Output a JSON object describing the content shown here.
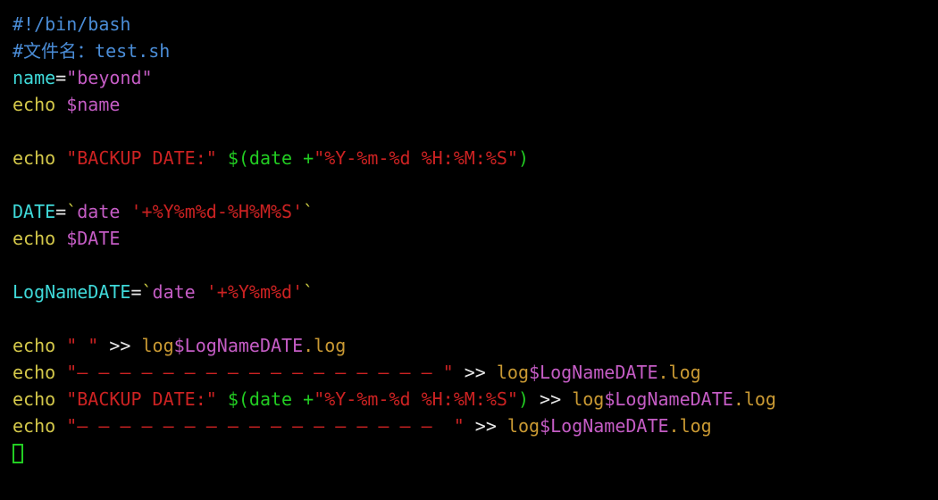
{
  "code": {
    "l1_shebang": "#!/bin/bash",
    "l2_comment": "#文件名：test.sh",
    "l3_name": "name",
    "l3_eq": "=",
    "l3_val": "\"beyond\"",
    "l4_echo": "echo",
    "l4_var": " $name",
    "l6_echo": "echo",
    "l6_str": " \"BACKUP DATE:\"",
    "l6_sub_open": " $(",
    "l6_date": "date ",
    "l6_plus": "+",
    "l6_fmt": "\"%Y-%m-%d %H:%M:%S\"",
    "l6_sub_close": ")",
    "l8_var": "DATE",
    "l8_eq": "=",
    "l8_bt1": "`",
    "l8_date": "date ",
    "l8_fmt": "'+%Y%m%d-%H%M%S'",
    "l8_bt2": "`",
    "l9_echo": "echo",
    "l9_var": " $DATE",
    "l11_var": "LogNameDATE",
    "l11_eq": "=",
    "l11_bt1": "`",
    "l11_date": "date ",
    "l11_fmt": "'+%Y%m%d'",
    "l11_bt2": "`",
    "l13_echo": "echo",
    "l13_str": " \" \"",
    "l13_redir": " >> ",
    "l13_log": "log",
    "l13_var": "$LogNameDATE",
    "l13_ext": ".log",
    "l14_echo": "echo",
    "l14_q1": " \"",
    "l14_dash": "— — — — — — — — — — — — — — — — — ",
    "l14_q2": "\"",
    "l14_redir": " >> ",
    "l14_log": "log",
    "l14_var": "$LogNameDATE",
    "l14_ext": ".log",
    "l15_echo": "echo",
    "l15_str": " \"BACKUP DATE:\"",
    "l15_sub_open": " $(",
    "l15_date": "date ",
    "l15_plus": "+",
    "l15_fmt": "\"%Y-%m-%d %H:%M:%S\"",
    "l15_sub_close": ")",
    "l15_redir": " >> ",
    "l15_log": "log",
    "l15_var": "$LogNameDATE",
    "l15_ext": ".log",
    "l16_echo": "echo",
    "l16_q1": " \"",
    "l16_dash": "— — — — — — — — — — — — — — — — —  ",
    "l16_q2": "\"",
    "l16_redir": " >> ",
    "l16_log": "log",
    "l16_var": "$LogNameDATE",
    "l16_ext": ".log"
  }
}
